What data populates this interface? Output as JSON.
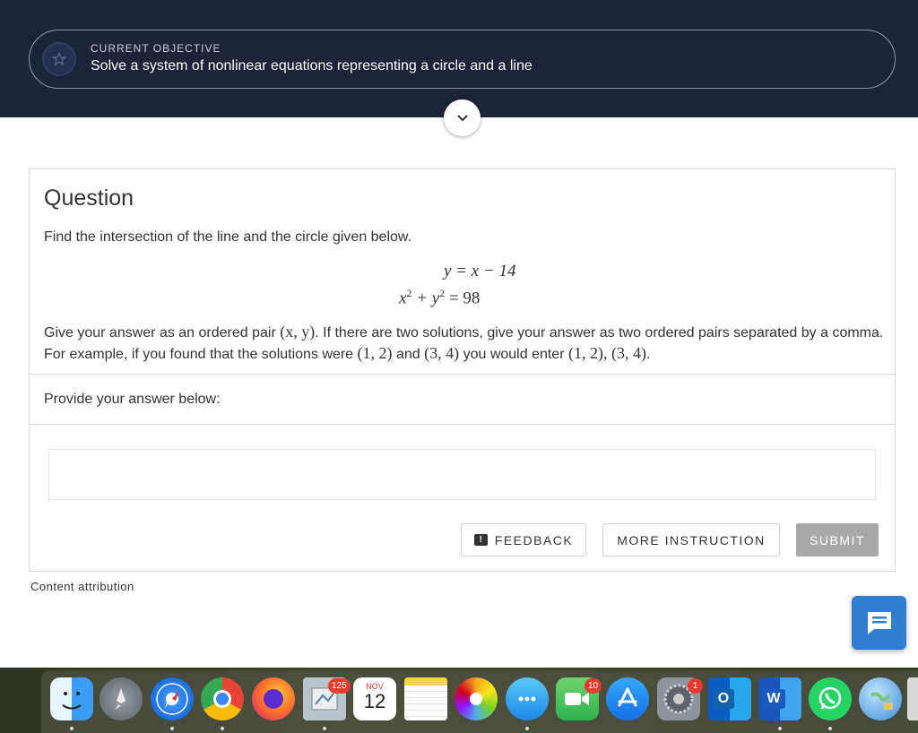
{
  "header": {
    "objective_label": "CURRENT OBJECTIVE",
    "objective_text": "Solve a system of nonlinear equations representing a circle and a line",
    "objective_icon": "star-icon",
    "expand_icon": "chevron-down-icon"
  },
  "question": {
    "title": "Question",
    "prompt": "Find the intersection of the line and the circle given below.",
    "equation_1": "y = x − 14",
    "equation_2_lhs": "x",
    "equation_2_mid": " + y",
    "equation_2_rhs": " = 98",
    "exponent": "2",
    "instruction_part1": "Give your answer as an ordered pair ",
    "pair_xy": "(x, y)",
    "instruction_part2": ". If there are two solutions, give your answer as two ordered pairs separated by a comma. For example, if you found that the solutions were ",
    "pair_12": "(1, 2)",
    "instruction_and": " and ",
    "pair_34": "(3, 4)",
    "instruction_part3": " you would enter ",
    "pair_both": "(1, 2), (3, 4)",
    "instruction_end": ".",
    "answer_label": "Provide your answer below:",
    "answer_value": ""
  },
  "buttons": {
    "feedback": "FEEDBACK",
    "more_instruction": "MORE INSTRUCTION",
    "submit": "SUBMIT"
  },
  "attribution": "Content attribution",
  "chat_icon": "chat-icon",
  "dock": {
    "mail_badge": "125",
    "calendar_month": "NOV",
    "calendar_day": "12",
    "facetime_badge": "10",
    "settings_badge": "1",
    "outlook_letter": "O",
    "word_letter": "W"
  },
  "colors": {
    "header_bg": "#1d2439",
    "submit_bg": "#a9a9a9",
    "chat_bg": "#2f7ecf"
  }
}
